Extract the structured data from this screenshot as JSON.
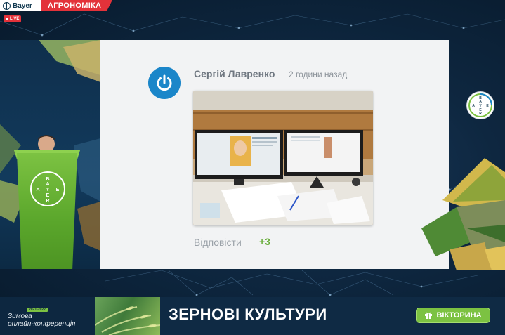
{
  "topbar": {
    "brand": "Bayer",
    "program": "АГРОНОМІКА",
    "live_label": "LIVE"
  },
  "podium": {
    "logo_text": [
      "B",
      "A",
      "Y",
      "E",
      "R"
    ]
  },
  "post": {
    "author": "Сергій Лавренко",
    "time": "2 години назад",
    "reply_label": "Відповісти",
    "reply_count": "+3",
    "avatar_icon": "power-icon"
  },
  "panel": {
    "logo_text": [
      "B",
      "A",
      "Y",
      "E",
      "R"
    ]
  },
  "footer": {
    "year_tag": "2021-2022",
    "conference_line1": "Зимова",
    "conference_line2": "онлайн-конференція",
    "title": "ЗЕРНОВІ КУЛЬТУРИ",
    "quiz_label": "ВІКТОРИНА",
    "quiz_icon": "gift-icon"
  },
  "colors": {
    "accent_red": "#e3323a",
    "accent_green": "#7cc242",
    "bayer_blue": "#1b86c9",
    "background": "#0e2740"
  }
}
